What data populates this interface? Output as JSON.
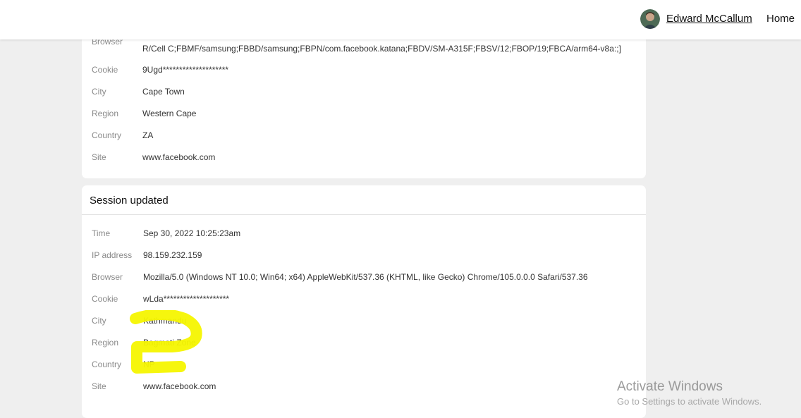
{
  "header": {
    "user_name": "Edward McCallum",
    "home_label": "Home"
  },
  "session_1": {
    "rows": [
      {
        "label": "Browser",
        "value": "R/Cell C;FBMF/samsung;FBBD/samsung;FBPN/com.facebook.katana;FBDV/SM-A315F;FBSV/12;FBOP/19;FBCA/arm64-v8a:;]"
      },
      {
        "label": "Cookie",
        "value": "9Ugd********************"
      },
      {
        "label": "City",
        "value": "Cape Town"
      },
      {
        "label": "Region",
        "value": "Western Cape"
      },
      {
        "label": "Country",
        "value": "ZA"
      },
      {
        "label": "Site",
        "value": "www.facebook.com"
      }
    ]
  },
  "session_2": {
    "title": "Session updated",
    "rows": [
      {
        "label": "Time",
        "value": "Sep 30, 2022 10:25:23am"
      },
      {
        "label": "IP address",
        "value": "98.159.232.159"
      },
      {
        "label": "Browser",
        "value": "Mozilla/5.0 (Windows NT 10.0; Win64; x64) AppleWebKit/537.36 (KHTML, like Gecko) Chrome/105.0.0.0 Safari/537.36"
      },
      {
        "label": "Cookie",
        "value": "wLda********************"
      },
      {
        "label": "City",
        "value": "Kathmandu"
      },
      {
        "label": "Region",
        "value": "Bagmati Zone"
      },
      {
        "label": "Country",
        "value": "NP"
      },
      {
        "label": "Site",
        "value": "www.facebook.com"
      }
    ]
  },
  "watermark": {
    "line1": "Activate Windows",
    "line2": "Go to Settings to activate Windows."
  },
  "colors": {
    "highlight": "#f5f500",
    "background": "#efefef"
  }
}
